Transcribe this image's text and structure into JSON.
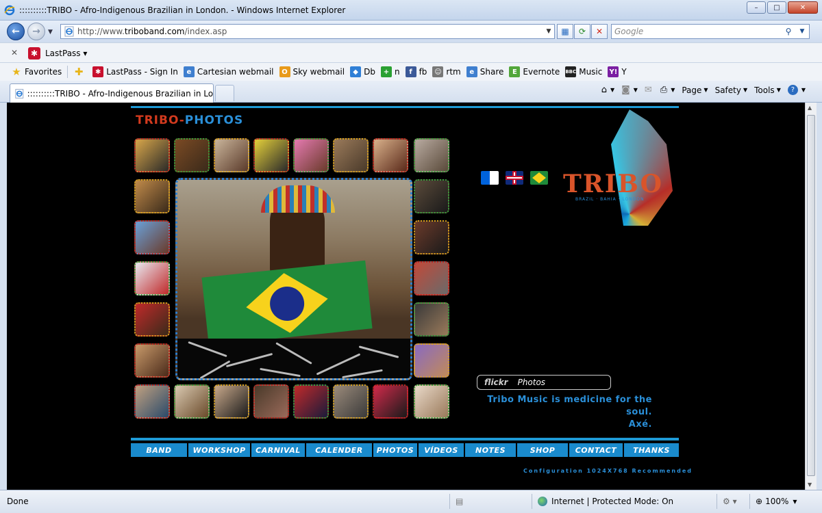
{
  "window": {
    "title": "::::::::::TRIBO - Afro-Indigenous Brazilian in London. - Windows Internet Explorer",
    "minimize": "–",
    "maximize": "□",
    "close": "✕"
  },
  "navigation": {
    "url_prefix": "http://www.",
    "url_domain": "triboband.com",
    "url_path": "/index.asp",
    "search_placeholder": "Google"
  },
  "lastpass_toolbar": {
    "close": "✕",
    "label": "LastPass"
  },
  "favorites_bar": {
    "favorites_label": "Favorites",
    "items": [
      {
        "label": "LastPass - Sign In",
        "icon": "lastpass-icon",
        "color": "#c8102e"
      },
      {
        "label": "Cartesian webmail",
        "icon": "ie-page-icon",
        "color": "#3f7fcf"
      },
      {
        "label": "Sky webmail",
        "icon": "sky-icon",
        "color": "#e89a1a"
      },
      {
        "label": "Db",
        "icon": "dropbox-icon",
        "color": "#2f7fd6"
      },
      {
        "label": "n",
        "icon": "plus-icon",
        "color": "#2aa032"
      },
      {
        "label": "fb",
        "icon": "facebook-icon",
        "color": "#3b5998"
      },
      {
        "label": "rtm",
        "icon": "cow-icon",
        "color": "#777777"
      },
      {
        "label": "Share",
        "icon": "ie-page-icon",
        "color": "#3f7fcf"
      },
      {
        "label": "Evernote",
        "icon": "evernote-icon",
        "color": "#52a63a"
      },
      {
        "label": "Music",
        "icon": "bbc-icon",
        "color": "#222222"
      },
      {
        "label": "Y",
        "icon": "yahoo-icon",
        "color": "#7b1fa2"
      }
    ]
  },
  "tabs": {
    "active_tab": "::::::::::TRIBO - Afro-Indigenous Brazilian in Lond...",
    "commands": [
      "Page",
      "Safety",
      "Tools"
    ]
  },
  "page": {
    "section_title_part1": "TRIBO-",
    "section_title_part2": "PHOTOS",
    "language_flags": [
      "flickr-flag-icon",
      "uk-flag-icon",
      "brazil-flag-icon"
    ],
    "logo_word": "TRIBO",
    "logo_sub": "BRAZIL · BAHIA · LONDON",
    "flickr_brand": "flickr",
    "flickr_label": "Photos",
    "slogan_line1": "Tribo Music is medicine for the soul.",
    "slogan_line2": "Axé.",
    "menu": [
      "BAND",
      "WORKSHOP",
      "CARNIVAL",
      "CALENDER",
      "PHOTOS",
      "VÍDEOS",
      "NOTES",
      "SHOP",
      "CONTACT",
      "THANKS"
    ],
    "config_note": "Configuration 1024X768 Recommended",
    "colors": {
      "accent_blue": "#1e9ad6",
      "title_red": "#d33a1e",
      "background": "#000000"
    }
  },
  "statusbar": {
    "status": "Done",
    "zone": "Internet | Protected Mode: On",
    "zoom": "100%"
  }
}
